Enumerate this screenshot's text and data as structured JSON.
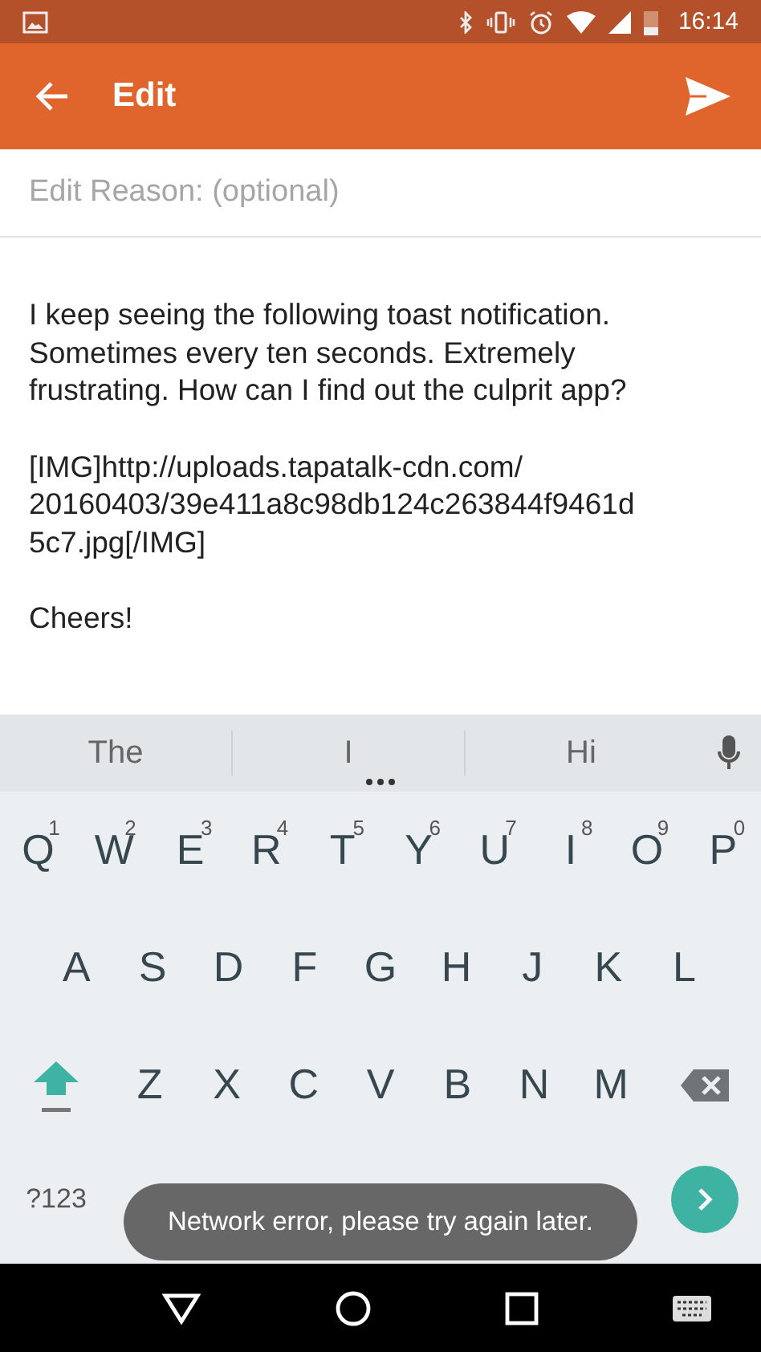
{
  "status_bar": {
    "time": "16:14"
  },
  "app_bar": {
    "title": "Edit"
  },
  "edit_reason": {
    "placeholder": "Edit Reason: (optional)"
  },
  "body": [
    {
      "lines": [
        "I keep seeing the following toast notification.",
        "Sometimes every ten seconds. Extremely",
        "frustrating. How can I find out the culprit app?"
      ]
    },
    {
      "lines": [
        "[IMG]http://uploads.tapatalk-cdn.com/",
        "20160403/39e411a8c98db124c263844f9461d",
        "5c7.jpg[/IMG]"
      ]
    },
    {
      "lines": [
        "Cheers!"
      ]
    }
  ],
  "keyboard": {
    "suggestions": [
      "The",
      "I",
      "Hi"
    ],
    "rows": [
      [
        {
          "label": "Q",
          "hint": "1"
        },
        {
          "label": "W",
          "hint": "2"
        },
        {
          "label": "E",
          "hint": "3"
        },
        {
          "label": "R",
          "hint": "4"
        },
        {
          "label": "T",
          "hint": "5"
        },
        {
          "label": "Y",
          "hint": "6"
        },
        {
          "label": "U",
          "hint": "7"
        },
        {
          "label": "I",
          "hint": "8"
        },
        {
          "label": "O",
          "hint": "9"
        },
        {
          "label": "P",
          "hint": "0"
        }
      ],
      [
        {
          "label": "A"
        },
        {
          "label": "S"
        },
        {
          "label": "D"
        },
        {
          "label": "F"
        },
        {
          "label": "G"
        },
        {
          "label": "H"
        },
        {
          "label": "J"
        },
        {
          "label": "K"
        },
        {
          "label": "L"
        }
      ],
      [
        {
          "label": "Z"
        },
        {
          "label": "X"
        },
        {
          "label": "C"
        },
        {
          "label": "V"
        },
        {
          "label": "B"
        },
        {
          "label": "N"
        },
        {
          "label": "M"
        }
      ]
    ],
    "symbols_key": "?123"
  },
  "toast": {
    "text": "Network error, please try again later."
  }
}
